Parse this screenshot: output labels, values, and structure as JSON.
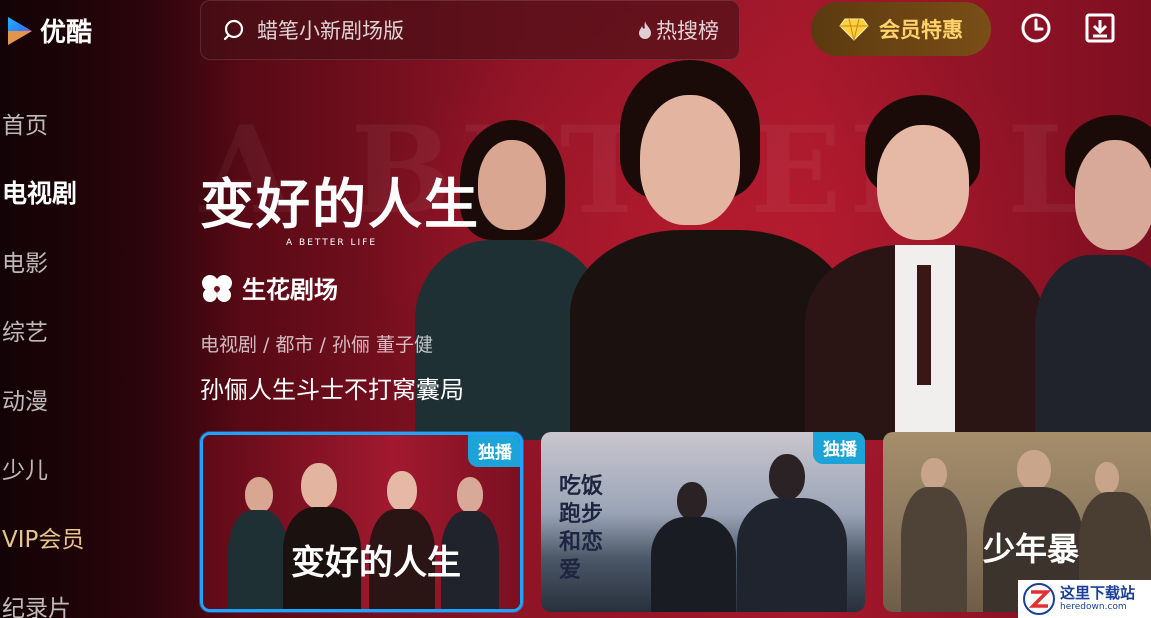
{
  "app": {
    "name": "优酷"
  },
  "search": {
    "placeholder_text": "蜡笔小新剧场版",
    "hot_label": "热搜榜"
  },
  "header": {
    "vip_button": "会员特惠"
  },
  "sidebar": {
    "items": [
      {
        "label": "首页"
      },
      {
        "label": "电视剧"
      },
      {
        "label": "电影"
      },
      {
        "label": "综艺"
      },
      {
        "label": "动漫"
      },
      {
        "label": "少儿"
      },
      {
        "label": "VIP会员"
      },
      {
        "label": "纪录片"
      }
    ],
    "active_index": 1
  },
  "hero": {
    "title": "变好的人生",
    "title_en": "A BETTER LIFE",
    "brand": "生花剧场",
    "meta": "电视剧 / 都市 / 孙俪 董子健",
    "tagline": "孙俪人生斗士不打窝囊局"
  },
  "cards": [
    {
      "title": "变好的人生",
      "badge": "独播"
    },
    {
      "title": "吃饭跑步和恋爱",
      "badge": "独播"
    },
    {
      "title": "少年暴"
    }
  ],
  "watermark": {
    "cn": "这里下载站",
    "en": "heredown.com"
  },
  "colors": {
    "accent": "#1ea4ff",
    "badge": "#1ca4d8",
    "vip_gold": "#ffd36a"
  }
}
